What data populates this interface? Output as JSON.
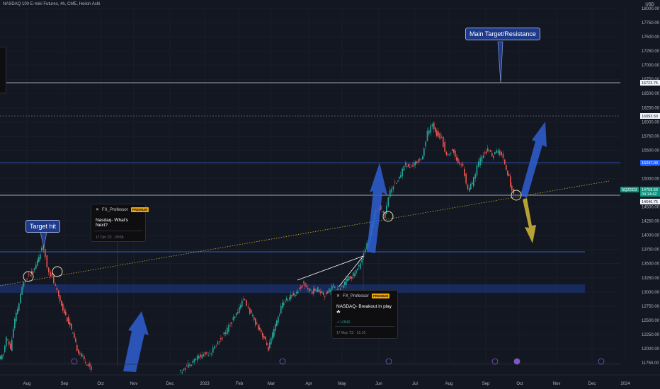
{
  "header": {
    "title": "NASDAQ 100 E-mini Futures, 4h, CME, Heikin Ashi",
    "currency": "USD"
  },
  "chart_data": {
    "type": "candlestick",
    "ylim": [
      11500,
      18100
    ],
    "y_ticks": [
      18000,
      17750,
      17500,
      17250,
      17000,
      16750,
      16500,
      16250,
      16000,
      15750,
      15500,
      15250,
      15000,
      14750,
      14500,
      14250,
      14000,
      13750,
      13500,
      13250,
      13000,
      12750,
      12500,
      12250,
      12000,
      11750
    ],
    "x_ticks": [
      "Aug",
      "Sep",
      "Oct",
      "Nov",
      "Dec",
      "2023",
      "Feb",
      "Mar",
      "Apr",
      "May",
      "Jun",
      "Jul",
      "Aug",
      "Sep",
      "Oct",
      "Nov",
      "Dec",
      "2024"
    ],
    "price_labels": [
      {
        "value": "16722.75",
        "style": "white"
      },
      {
        "value": "16093.50",
        "style": "white"
      },
      {
        "value": "15247.00",
        "style": "blue"
      },
      {
        "value": "14759.50",
        "style": "green"
      },
      {
        "value": "04:14:42",
        "style": "green"
      },
      {
        "value": "14646.75",
        "style": "white"
      }
    ],
    "symbol_tag": "NQZ2023",
    "annotations": [
      "Main Target/Resistance",
      "Target hit"
    ],
    "path": [
      [
        0,
        11800
      ],
      [
        6,
        11900
      ],
      [
        10,
        12200
      ],
      [
        16,
        12000
      ],
      [
        22,
        12500
      ],
      [
        28,
        12800
      ],
      [
        35,
        13200
      ],
      [
        42,
        13300
      ],
      [
        50,
        13400
      ],
      [
        58,
        13700
      ],
      [
        63,
        13800
      ],
      [
        68,
        13450
      ],
      [
        75,
        13250
      ],
      [
        82,
        13000
      ],
      [
        90,
        12700
      ],
      [
        100,
        12400
      ],
      [
        110,
        12000
      ],
      [
        120,
        11800
      ],
      [
        130,
        11650
      ],
      [
        250,
        11500
      ],
      [
        265,
        11700
      ],
      [
        280,
        11850
      ],
      [
        300,
        11950
      ],
      [
        320,
        12300
      ],
      [
        335,
        12600
      ],
      [
        345,
        12900
      ],
      [
        352,
        12700
      ],
      [
        360,
        12500
      ],
      [
        370,
        12300
      ],
      [
        380,
        12000
      ],
      [
        390,
        12400
      ],
      [
        400,
        12800
      ],
      [
        410,
        12900
      ],
      [
        420,
        13000
      ],
      [
        430,
        13150
      ],
      [
        440,
        13000
      ],
      [
        450,
        13050
      ],
      [
        460,
        12950
      ],
      [
        470,
        13100
      ],
      [
        480,
        13000
      ],
      [
        490,
        13200
      ],
      [
        500,
        13300
      ],
      [
        508,
        13450
      ],
      [
        515,
        13700
      ],
      [
        522,
        13900
      ],
      [
        530,
        14400
      ],
      [
        537,
        14500
      ],
      [
        545,
        14350
      ],
      [
        550,
        14700
      ],
      [
        557,
        14900
      ],
      [
        565,
        15000
      ],
      [
        572,
        15250
      ],
      [
        580,
        15200
      ],
      [
        590,
        15300
      ],
      [
        598,
        15400
      ],
      [
        605,
        15800
      ],
      [
        612,
        15950
      ],
      [
        618,
        15800
      ],
      [
        625,
        15700
      ],
      [
        632,
        15400
      ],
      [
        640,
        15500
      ],
      [
        648,
        15300
      ],
      [
        655,
        15200
      ],
      [
        662,
        14800
      ],
      [
        668,
        14900
      ],
      [
        675,
        15200
      ],
      [
        682,
        15400
      ],
      [
        690,
        15500
      ],
      [
        698,
        15400
      ],
      [
        705,
        15500
      ],
      [
        712,
        15350
      ],
      [
        718,
        15100
      ],
      [
        722,
        14900
      ],
      [
        727,
        14700
      ]
    ]
  },
  "callouts": [
    {
      "author": "FX_Professor",
      "badge": "PREMIUM",
      "title": "Nasdaq- What's Next?",
      "date": "17 Oct '22 · 20:55"
    },
    {
      "author": "FX_Professor",
      "badge": "PREMIUM",
      "title": "NASDAQ- Breakout in play ☘",
      "tag": "↗ LONG",
      "date": "17 May '23 · 21:10"
    }
  ],
  "labels": {
    "main_target": "Main Target/Resistance",
    "target_hit": "Target hit"
  },
  "colors": {
    "up": "#26a69a",
    "down": "#ef5350",
    "background": "#131722",
    "zone": "#1e3a8a",
    "arrow_up": "#2f5fd1",
    "arrow_down": "#c9b037"
  }
}
